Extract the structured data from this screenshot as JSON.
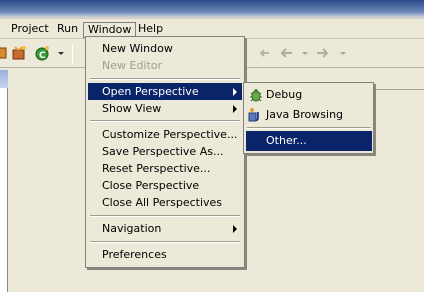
{
  "menubar": {
    "items": [
      {
        "label": "Project"
      },
      {
        "label": "Run"
      },
      {
        "label": "Window"
      },
      {
        "label": "Help"
      }
    ]
  },
  "window_menu": {
    "items": [
      {
        "label": "New Window",
        "enabled": true
      },
      {
        "label": "New Editor",
        "enabled": false
      },
      {
        "label": "Open Perspective",
        "enabled": true,
        "submenu": true,
        "selected": true
      },
      {
        "label": "Show View",
        "enabled": true,
        "submenu": true
      },
      {
        "label": "Customize Perspective...",
        "enabled": true
      },
      {
        "label": "Save Perspective As...",
        "enabled": true
      },
      {
        "label": "Reset Perspective...",
        "enabled": true
      },
      {
        "label": "Close Perspective",
        "enabled": true
      },
      {
        "label": "Close All Perspectives",
        "enabled": true
      },
      {
        "label": "Navigation",
        "enabled": true,
        "submenu": true
      },
      {
        "label": "Preferences",
        "enabled": true
      }
    ]
  },
  "open_perspective_submenu": {
    "items": [
      {
        "label": "Debug",
        "icon": "debug-bug-icon"
      },
      {
        "label": "Java Browsing",
        "icon": "java-browsing-icon"
      },
      {
        "label": "Other...",
        "selected": true
      }
    ]
  },
  "colors": {
    "selection": "#0a246a",
    "menu_bg": "#ece9d8",
    "disabled_text": "#a09c90"
  }
}
